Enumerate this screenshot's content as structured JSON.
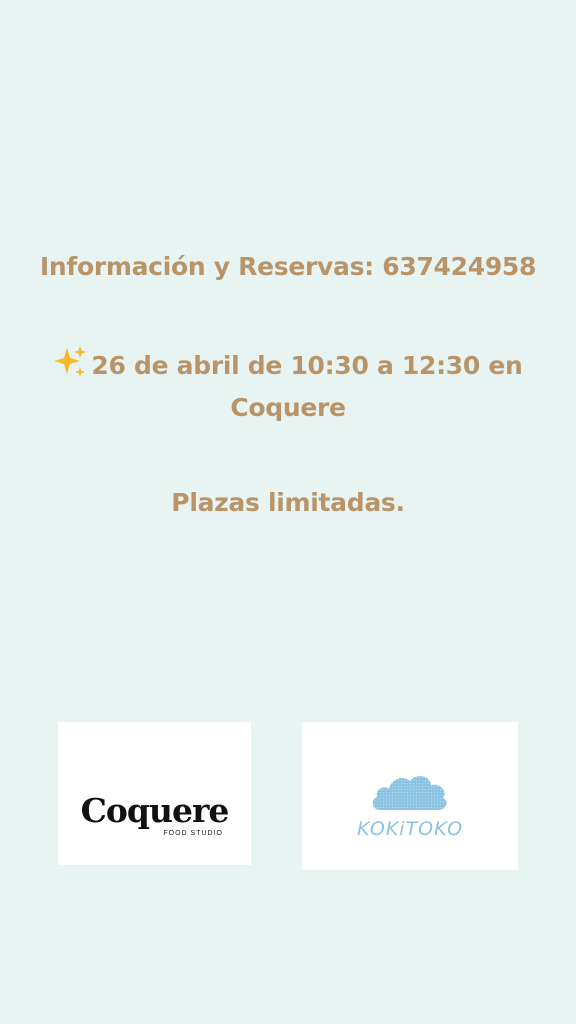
{
  "info": {
    "text": "Información y Reservas: 637424958"
  },
  "event": {
    "sparkle_icon": "sparkles-icon",
    "date_line1": "26 de abril de 10:30 a 12:30 en",
    "date_line2": "Coquere"
  },
  "plazas": {
    "text": "Plazas limitadas."
  },
  "logos": {
    "coquere": {
      "name": "Coquere",
      "subtitle": "FOOD STUDIO"
    },
    "kokitoko": {
      "name": "KOKiTOKO",
      "cloud_icon": "cloud-icon",
      "color": "#8cc3e2"
    }
  },
  "colors": {
    "background": "#e8f4f2",
    "text": "#b89468"
  }
}
